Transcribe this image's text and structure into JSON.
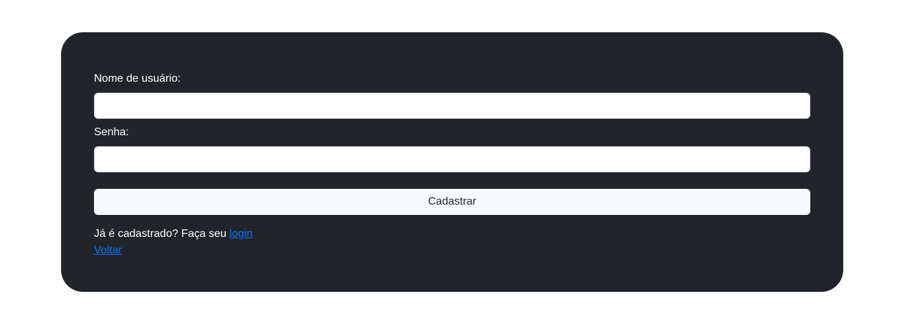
{
  "form": {
    "username_label": "Nome de usuário:",
    "username_value": "",
    "password_label": "Senha:",
    "password_value": "",
    "submit_label": "Cadastrar",
    "login_prompt": "Já é cadastrado? Faça seu ",
    "login_link": "login",
    "back_link": "Voltar"
  },
  "colors": {
    "card_background": "#212529",
    "link": "#0d6efd",
    "button_background": "#f8f9fa"
  }
}
